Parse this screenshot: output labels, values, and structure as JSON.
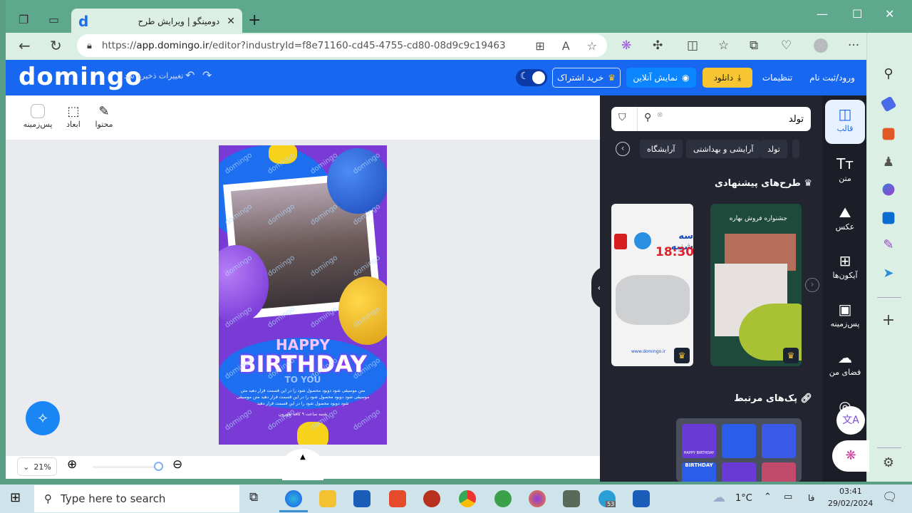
{
  "browser": {
    "tab_title": "دومینگو | ویرایش طرح",
    "tab_favicon": "d",
    "url_scheme": "https://",
    "url_host": "app.domingo.ir",
    "url_path": "/editor?industryId=f8e71160-cd45-4755-cd80-08d9c9c19463",
    "icons": [
      "workspaces-icon",
      "tab-actions-icon",
      "back-icon",
      "refresh-icon",
      "lock-icon",
      "app-available-icon",
      "read-aloud-icon",
      "favorite-star-icon",
      "copilot-brain-icon",
      "extensions-icon",
      "split-screen-icon",
      "favorites-list-icon",
      "collections-icon",
      "browser-essentials-icon",
      "profile-icon",
      "more-icon",
      "copilot-icon"
    ],
    "window_controls": {
      "minimize": "—",
      "maximize": "☐",
      "close": "✕"
    }
  },
  "edge_sidebar": {
    "items": [
      "search-icon",
      "shopping-tag-icon",
      "tools-icon",
      "games-icon",
      "microsoft365-icon",
      "outlook-icon",
      "designer-icon",
      "telegram-icon"
    ],
    "add_label": "+",
    "settings_label": "⚙"
  },
  "header": {
    "logo": "domingo",
    "saved_status": "تغییرات ذخیره شد",
    "login": "ورود/ثبت نام",
    "settings": "تنظیمات",
    "download": "دانلود",
    "preview": "نمایش آنلاین",
    "subscribe": "خرید اشتراک",
    "colors": {
      "brand": "#1867f0",
      "download_bg": "#f7c531",
      "preview_bg": "#0b86ff"
    }
  },
  "canvas_tools": [
    {
      "label": "محتوا",
      "icon": "edit-icon"
    },
    {
      "label": "ابعاد",
      "icon": "resize-icon"
    },
    {
      "label": "پس‌زمینه",
      "icon": "background-color-icon"
    }
  ],
  "design": {
    "watermark": "domingo",
    "line1": "HAPPY",
    "line2": "BIRTHDAY",
    "line3": "TO YOU",
    "body_text": "متن موسیقی شود دوبود محصول شود را در این قسمت قرار دهید متن موسیقی شود دوبود محصول شود را در این قسمت قرار دهید متن موسیقی شود دوبود محصول شود را در این قسمت قرار دهید",
    "footer_text": "شنبه ساعت ۹ کافه طهرون"
  },
  "zoom": {
    "percent": "21%",
    "slider_value": 0.21
  },
  "panel": {
    "search_value": "تولد",
    "chips": [
      "تولد",
      "آرایشی و بهداشتی",
      "آرایشگاه"
    ],
    "suggested_title": "طرح‌های پیشنهادی",
    "related_title": "پک‌های مرتبط",
    "cards": [
      {
        "title": "جشنواره فروش بهاره",
        "premium": true
      },
      {
        "title": "سه شنبه",
        "time": "18:30",
        "site": "www.domingo.ir",
        "premium": true
      }
    ],
    "pack_labels": [
      "HAPPY BIRTHDAY",
      "BIRTHDAY"
    ]
  },
  "rail": [
    {
      "label": "قالب",
      "icon": "template-icon",
      "active": true
    },
    {
      "label": "متن",
      "icon": "text-icon"
    },
    {
      "label": "عکس",
      "icon": "photo-icon"
    },
    {
      "label": "آیکون‌ها",
      "icon": "icons-grid-icon"
    },
    {
      "label": "پس‌زمینه",
      "icon": "background-icon"
    },
    {
      "label": "فضای من",
      "icon": "upload-cloud-icon"
    }
  ],
  "taskbar": {
    "search_placeholder": "Type here to search",
    "weather": "1°C",
    "lang": "فا",
    "time": "03:41",
    "date": "29/02/2024",
    "telegram_badge": "53",
    "apps": [
      "edge",
      "file-explorer",
      "store",
      "cursor-app",
      "p-app",
      "chrome",
      "idm",
      "firefox",
      "terminal",
      "telegram",
      "word"
    ]
  }
}
